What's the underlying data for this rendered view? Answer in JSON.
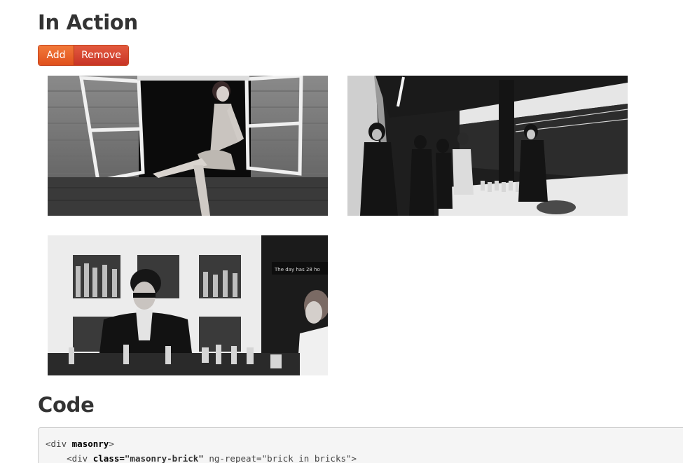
{
  "section_action": {
    "title": "In Action",
    "buttons": {
      "add_label": "Add",
      "remove_label": "Remove"
    },
    "bricks": [
      {
        "alt": "Woman sitting in an open window",
        "style": "grayscale"
      },
      {
        "alt": "People at a bar counter by a glass window",
        "style": "grayscale"
      },
      {
        "alt": "Bartender with sunglasses preparing drinks",
        "style": "grayscale",
        "sign_text": "The day has 28 ho"
      }
    ]
  },
  "section_code": {
    "title": "Code",
    "lines": [
      {
        "open": "<div ",
        "kw": "masonry",
        "close": ">"
      },
      {
        "indent": "    ",
        "open": "<div ",
        "kw": "class=",
        "str": "\"masonry-brick\"",
        "rest": " ng-repeat=\"brick in bricks\">"
      }
    ]
  },
  "colors": {
    "add_button": "#e8602a",
    "remove_button": "#d4432f",
    "code_bg": "#f5f5f5"
  }
}
